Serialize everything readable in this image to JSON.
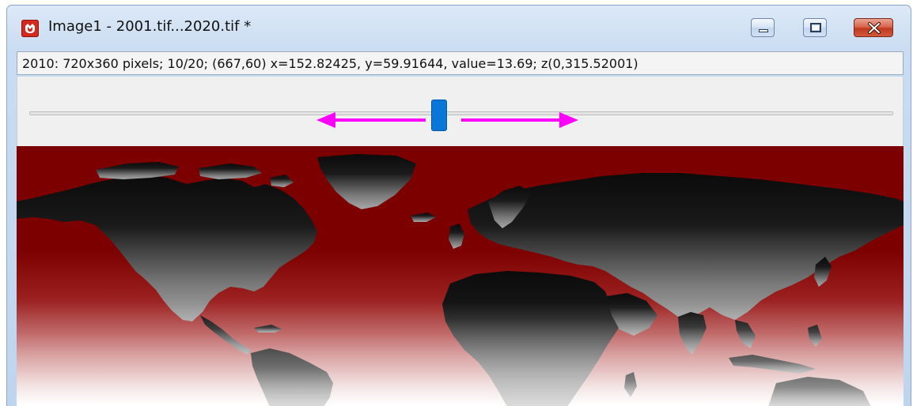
{
  "window": {
    "title": "Image1 - 2001.tif...2020.tif *",
    "app_icon": "origin-app-icon",
    "controls": {
      "minimize_icon": "minimize-icon",
      "maximize_icon": "restore-icon",
      "close_icon": "close-icon"
    }
  },
  "status_bar": {
    "text": "2010: 720x360 pixels; 10/20; (667,60) x=152.82425, y=59.91644, value=13.69; z(0,315.52001)"
  },
  "slider": {
    "current_frame": 10,
    "total_frames": 20,
    "position_fraction": 0.474,
    "arrow_color": "#ff00ff",
    "thumb_color": "#0a76d8"
  },
  "image": {
    "content": "world-map-raster",
    "background_color": "#7c0000",
    "land_color_range": [
      "#0a0a0a",
      "#9a9a9a"
    ]
  }
}
